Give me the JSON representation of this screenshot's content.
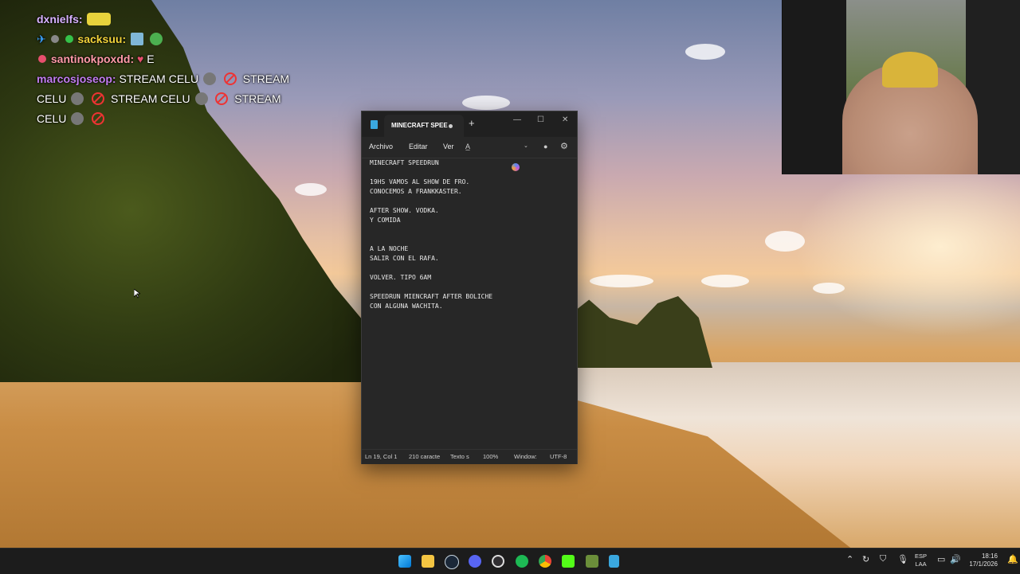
{
  "chat": {
    "messages": [
      {
        "user": "dxnielfs:",
        "text": "",
        "user_color": "#d8b2ff"
      },
      {
        "user": "sacksuu:",
        "text": "",
        "user_color": "#f2d33a"
      },
      {
        "user": "santinokpoxdd:",
        "text": "E",
        "user_color": "#ff9aa8"
      },
      {
        "user": "marcosjoseop:",
        "text": "STREAM CELU",
        "user_color": "#c27cf0"
      },
      {
        "text": "STREAM"
      },
      {
        "text": "CELU"
      },
      {
        "text": "STREAM CELU"
      },
      {
        "text": "STREAM"
      },
      {
        "text": "CELU"
      }
    ]
  },
  "notepad": {
    "tab_title": "MINECRAFT SPEE",
    "new_tab_symbol": "+",
    "menu": {
      "file": "Archivo",
      "edit": "Editar",
      "view": "Ver"
    },
    "content": "MINECRAFT SPEEDRUN\n\n19HS VAMOS AL SHOW DE FRO.\nCONOCEMOS A FRANKKASTER.\n\nAFTER SHOW. VODKA.\nY COMIDA\n\n\nA LA NOCHE\nSALIR CON EL RAFA.\n\nVOLVER. TIPO 6AM\n\nSPEEDRUN MIENCRAFT AFTER BOLICHE\nCON ALGUNA WACHITA.",
    "status": {
      "position": "Ln 19, Col 1",
      "chars": "210 caracte",
      "format": "Texto s",
      "zoom": "100%",
      "line_ending": "Window:",
      "encoding": "UTF-8"
    }
  },
  "taskbar": {
    "language": "ESP",
    "layout": "LAA",
    "time": "18:16",
    "date": "17/1/2026",
    "pinned_icons": [
      "windows-start-icon",
      "file-explorer-icon",
      "steam-icon",
      "discord-icon",
      "obs-icon",
      "spotify-icon",
      "chrome-icon",
      "kick-icon",
      "minecraft-icon",
      "notepad-icon"
    ]
  },
  "colors": {
    "notepad_bg": "#272727",
    "taskbar_bg": "#1c1c1c",
    "ban_red": "#ee3333"
  }
}
